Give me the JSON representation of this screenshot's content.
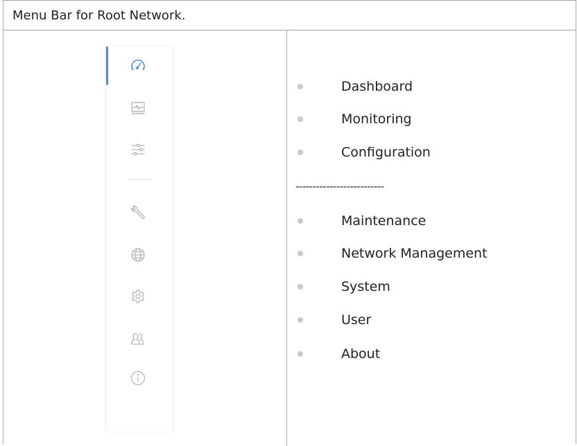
{
  "caption": "Menu Bar for Root Network.",
  "sidebar": {
    "active_color": "#4a90d9",
    "icon_color": "#b5b5b5",
    "icons": [
      {
        "name": "dashboard-gauge-icon",
        "active": true
      },
      {
        "name": "monitoring-icon",
        "active": false
      },
      {
        "name": "configuration-sliders-icon",
        "active": false
      },
      {
        "name": "maintenance-wrench-icon",
        "active": false
      },
      {
        "name": "network-globe-icon",
        "active": false
      },
      {
        "name": "system-gear-icon",
        "active": false
      },
      {
        "name": "user-icon",
        "active": false
      },
      {
        "name": "about-info-icon",
        "active": false
      }
    ]
  },
  "menu": {
    "group1": [
      "Dashboard",
      "Monitoring",
      "Configuration"
    ],
    "separator": "--------------------------",
    "group2": [
      "Maintenance",
      "Network Management",
      "System",
      "User",
      "About"
    ]
  }
}
